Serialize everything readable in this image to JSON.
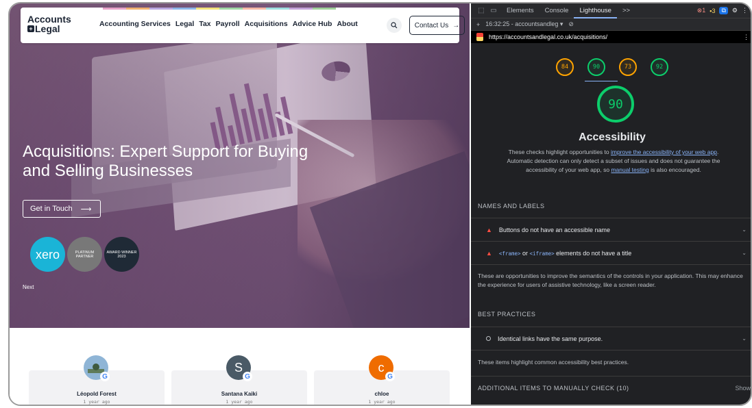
{
  "site": {
    "logo": {
      "line1": "Accounts",
      "line2": "Legal"
    },
    "nav": [
      "Accounting Services",
      "Legal",
      "Tax",
      "Payroll",
      "Acquisitions",
      "Advice Hub",
      "About"
    ],
    "contact_label": "Contact Us",
    "hero_title": "Acquisitions: Expert Support for Buying and Selling Businesses",
    "cta_label": "Get in Touch",
    "badges": {
      "xero": "xero",
      "platinum": "PLATINUM PARTNER",
      "award": "AWARD WINNER 2023"
    },
    "next_label": "Next",
    "reviews": [
      {
        "name": "Léopold Forest",
        "time": "1 year ago",
        "initial": "",
        "color": "#8fb5d6"
      },
      {
        "name": "Santana Kaiki",
        "time": "1 year ago",
        "initial": "S",
        "color": "#4a5a66"
      },
      {
        "name": "chloe",
        "time": "1 year ago",
        "initial": "c",
        "color": "#ef6c00"
      }
    ]
  },
  "devtools": {
    "tabs": [
      "Elements",
      "Console",
      "Lighthouse"
    ],
    "more_tabs": ">>",
    "error_count": "1",
    "warning_count": "3",
    "session": "16:32:25 - accountsandleg",
    "url": "https://accountsandlegal.co.uk/acquisitions/",
    "scores": [
      "84",
      "90",
      "73",
      "92"
    ],
    "main_score": "90",
    "category_title": "Accessibility",
    "description": {
      "part1": "These checks highlight opportunities to ",
      "link1": "improve the accessibility of your web app",
      "part2": ". Automatic detection can only detect a subset of issues and does not guarantee the accessibility of your web app, so ",
      "link2": "manual testing",
      "part3": " is also encouraged."
    },
    "section_names": "NAMES AND LABELS",
    "audit1": "Buttons do not have an accessible name",
    "audit2_code1": "<frame>",
    "audit2_or": " or ",
    "audit2_code2": "<iframe>",
    "audit2_text": " elements do not have a title",
    "names_note": "These are opportunities to improve the semantics of the controls in your application. This may enhance the experience for users of assistive technology, like a screen reader.",
    "section_best": "BEST PRACTICES",
    "audit3": "Identical links have the same purpose.",
    "best_note": "These items highlight common accessibility best practices.",
    "section_manual": "ADDITIONAL ITEMS TO MANUALLY CHECK (10)",
    "show_label": "Show"
  },
  "colors": {
    "lh_orange": "#ffa400",
    "lh_green": "#0cce6b",
    "lh_red": "#ff4e42",
    "link_blue": "#8ab4f8",
    "devtools_bg": "#202124"
  }
}
